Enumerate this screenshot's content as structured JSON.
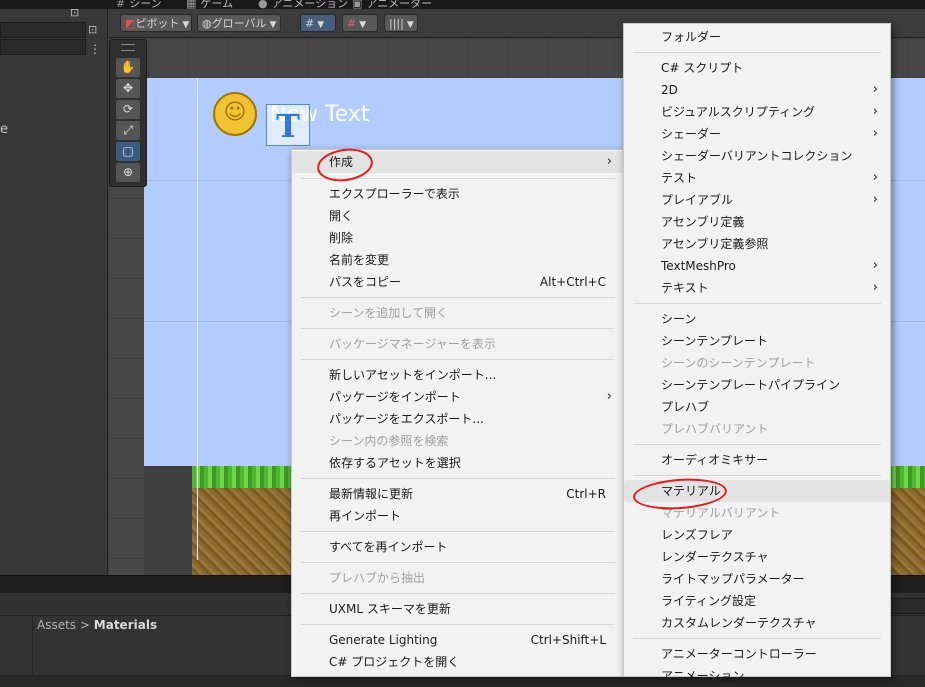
{
  "tabs": [
    {
      "icon": "#",
      "label": "シーン"
    },
    {
      "icon": "▦",
      "label": "ゲーム"
    },
    {
      "icon": "●",
      "label": "アニメーション"
    },
    {
      "icon": "▣",
      "label": "アニメーター"
    }
  ],
  "hierarchy": {
    "icon_lock": "⊡",
    "icon_menu": "⋮",
    "partial_label": "e"
  },
  "toolbar": {
    "pivot": "ピボット",
    "global": "グローバル",
    "grid_icon": "#",
    "snap_icon": "#",
    "ruler_icon": "||||"
  },
  "scene": {
    "text_object": "New Text",
    "text_icon": "T",
    "coin_face": "☺"
  },
  "tools": [
    "✋",
    "✥",
    "⟳",
    "⤢",
    "▢",
    "⊕"
  ],
  "project": {
    "breadcrumb_root": "Assets",
    "breadcrumb_sep": ">",
    "breadcrumb_current": "Materials"
  },
  "menu1": {
    "items": [
      {
        "label": "作成",
        "arrow": "›"
      },
      {
        "label": "エクスプローラーで表示"
      },
      {
        "label": "開く"
      },
      {
        "label": "削除"
      },
      {
        "label": "名前を変更"
      },
      {
        "label": "パスをコピー",
        "shortcut": "Alt+Ctrl+C"
      },
      {
        "label": "シーンを追加して開く"
      },
      {
        "label": "パッケージマネージャーを表示"
      },
      {
        "label": "新しいアセットをインポート..."
      },
      {
        "label": "パッケージをインポート",
        "arrow": "›"
      },
      {
        "label": "パッケージをエクスポート..."
      },
      {
        "label": "シーン内の参照を検索"
      },
      {
        "label": "依存するアセットを選択"
      },
      {
        "label": "最新情報に更新",
        "shortcut": "Ctrl+R"
      },
      {
        "label": "再インポート"
      },
      {
        "label": "すべてを再インポート"
      },
      {
        "label": "プレハブから抽出"
      },
      {
        "label": "UXML スキーマを更新"
      },
      {
        "label": "Generate Lighting",
        "shortcut": "Ctrl+Shift+L"
      },
      {
        "label": "C# プロジェクトを開く"
      }
    ]
  },
  "menu2": {
    "items": [
      {
        "label": "フォルダー"
      },
      {
        "label": "C# スクリプト"
      },
      {
        "label": "2D",
        "arrow": "›"
      },
      {
        "label": "ビジュアルスクリプティング",
        "arrow": "›"
      },
      {
        "label": "シェーダー",
        "arrow": "›"
      },
      {
        "label": "シェーダーバリアントコレクション"
      },
      {
        "label": "テスト",
        "arrow": "›"
      },
      {
        "label": "プレイアブル",
        "arrow": "›"
      },
      {
        "label": "アセンブリ定義"
      },
      {
        "label": "アセンブリ定義参照"
      },
      {
        "label": "TextMeshPro",
        "arrow": "›"
      },
      {
        "label": "テキスト",
        "arrow": "›"
      },
      {
        "label": "シーン"
      },
      {
        "label": "シーンテンプレート"
      },
      {
        "label": "シーンのシーンテンプレート"
      },
      {
        "label": "シーンテンプレートパイプライン"
      },
      {
        "label": "プレハブ"
      },
      {
        "label": "プレハブバリアント"
      },
      {
        "label": "オーディオミキサー"
      },
      {
        "label": "マテリアル"
      },
      {
        "label": "マテリアルバリアント"
      },
      {
        "label": "レンズフレア"
      },
      {
        "label": "レンダーテクスチャ"
      },
      {
        "label": "ライトマップパラメーター"
      },
      {
        "label": "ライティング設定"
      },
      {
        "label": "カスタムレンダーテクスチャ"
      },
      {
        "label": "アニメーターコントローラー"
      },
      {
        "label": "アニメーション"
      }
    ]
  },
  "colors": {
    "annotation": "#e21b1b",
    "sky": "#b2cdfd",
    "menu_bg": "#f2f2f2"
  }
}
